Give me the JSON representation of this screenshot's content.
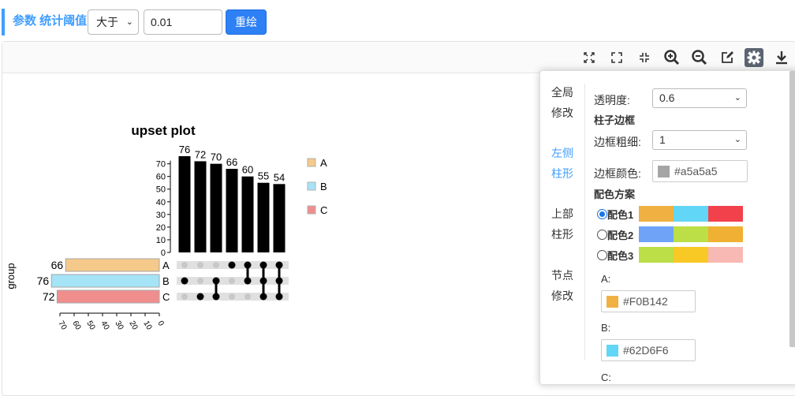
{
  "toolbar": {
    "param_label": "参数 统计阈值",
    "compare_value": "大于",
    "threshold_value": "0.01",
    "redraw_label": "重绘"
  },
  "chart_tools": [
    "fit-screen-icon",
    "fullscreen-icon",
    "exit-fullscreen-icon",
    "zoom-in-icon",
    "zoom-out-icon",
    "edit-icon",
    "gear-icon",
    "download-icon"
  ],
  "chart_data": {
    "type": "bar",
    "title": "upset plot",
    "intersections": {
      "values": [
        76,
        72,
        70,
        66,
        60,
        55,
        54
      ],
      "members": [
        [
          "B"
        ],
        [
          "C"
        ],
        [
          "B",
          "C"
        ],
        [
          "A"
        ],
        [
          "A",
          "B"
        ],
        [
          "A",
          "B",
          "C"
        ],
        [
          "A",
          "B",
          "C"
        ]
      ],
      "ylim": [
        0,
        76
      ],
      "yticks": [
        0,
        10,
        20,
        30,
        40,
        50,
        60,
        70
      ]
    },
    "sets": {
      "names": [
        "A",
        "B",
        "C"
      ],
      "sizes": [
        66,
        76,
        72
      ],
      "colors": [
        "#F5C98A",
        "#A5E3F7",
        "#F08E8E"
      ],
      "xticks": [
        70,
        60,
        50,
        40,
        30,
        20,
        10,
        0
      ],
      "ylabel": "group"
    },
    "legend": {
      "placement": "right",
      "items": [
        {
          "name": "A",
          "color": "#F5C98A"
        },
        {
          "name": "B",
          "color": "#A5E3F7"
        },
        {
          "name": "C",
          "color": "#F08E8E"
        }
      ]
    },
    "bar_color": "#000000"
  },
  "settings": {
    "nav": [
      {
        "label": "全局修改"
      },
      {
        "label": "左侧柱形"
      },
      {
        "label": "上部柱形"
      },
      {
        "label": "节点修改"
      }
    ],
    "opacity_label": "透明度:",
    "opacity_value": "0.6",
    "border_heading": "柱子边框",
    "border_width_label": "边框粗细:",
    "border_width_value": "1",
    "border_color_label": "边框颜色:",
    "border_color_value": "#a5a5a5",
    "scheme_heading": "配色方案",
    "schemes": [
      {
        "name": "配色1",
        "colors": [
          "#F0B142",
          "#62D6F6",
          "#F2414B"
        ]
      },
      {
        "name": "配色2",
        "colors": [
          "#6EA3F7",
          "#BCDE46",
          "#F0B033"
        ]
      },
      {
        "name": "配色3",
        "colors": [
          "#BCDE46",
          "#F8C825",
          "#F8B9B4"
        ]
      }
    ],
    "selected_scheme": 0,
    "colors": [
      {
        "label": "A:",
        "value": "#F0B142"
      },
      {
        "label": "B:",
        "value": "#62D6F6"
      },
      {
        "label": "C:",
        "value": ""
      }
    ]
  }
}
